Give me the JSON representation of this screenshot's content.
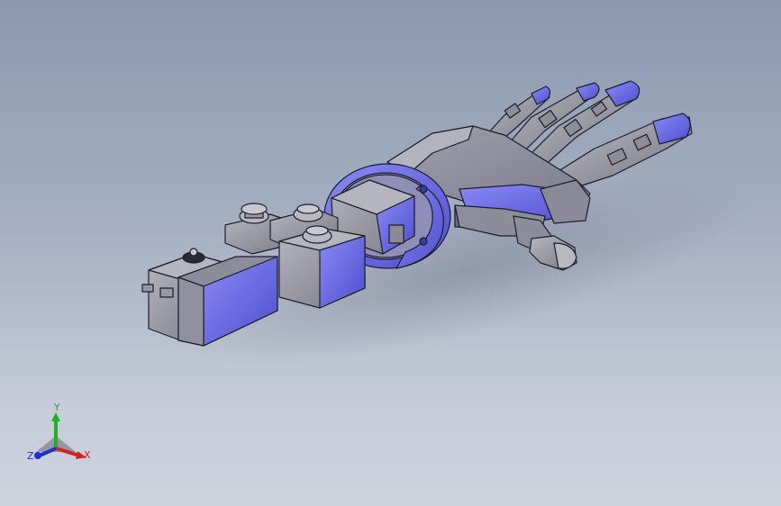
{
  "viewport": {
    "model": "robotic-hand-servo-assembly"
  },
  "colors": {
    "background_top": "#8b98ae",
    "background_bottom": "#ced4de",
    "part_blue": "#6a6ae8",
    "part_blue_dark": "#4b4bc4",
    "part_gray": "#9a9aa6",
    "part_gray_dark": "#6e6e7a",
    "edge": "#1e1e2a",
    "axis_x": "#d42020",
    "axis_y": "#20b020",
    "axis_z": "#2030d0"
  },
  "triad": {
    "x_label": "X",
    "y_label": "Y",
    "z_label": "Z"
  }
}
